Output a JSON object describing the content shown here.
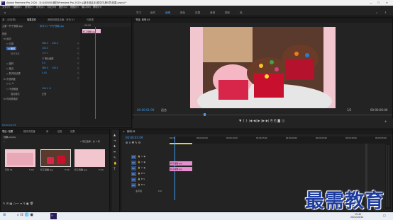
{
  "titlebar": {
    "title": "Adobe Premiere Pro 2020 - D:\\180000\\素材\\Premiere Pro 2020 从新手到高手\\源文件\\第5章\\效果.prproj *",
    "min": "—",
    "max": "☐",
    "close": "✕"
  },
  "menu": [
    "文件(F)",
    "编辑(E)",
    "剪辑(C)",
    "序列(S)",
    "标记(M)",
    "图形(G)",
    "视图(V)",
    "窗口(W)",
    "帮助(H)"
  ],
  "workspace": {
    "tabs": [
      "学习",
      "组件",
      "编辑",
      "颜色",
      "效果",
      "音频",
      "图形",
      "库"
    ],
    "active": "编辑"
  },
  "effect_controls": {
    "tabs": [
      "源：(无剪辑)",
      "效果控件",
      "音频剪辑混合器：序列 01",
      "元数据"
    ],
    "selected_tab": "效果控件",
    "clip_source": "主要 * 杯子蛋糕.jpg",
    "clip_sequence": "序列 01 * 杯子蛋糕.jpg",
    "timecode": "00:00",
    "clip_label": "杯子蛋糕.jpg",
    "rows": [
      {
        "label": "视频",
        "values": []
      },
      {
        "label": "fx 运动",
        "values": []
      },
      {
        "label": "○ 位置",
        "values": [
          "360.0",
          "240.0"
        ]
      },
      {
        "label": "○ 缩放",
        "values": [
          "100.0"
        ]
      },
      {
        "label": "缩放宽度",
        "values": [
          "100.0"
        ]
      },
      {
        "label": "",
        "values": [
          "等比缩放"
        ]
      },
      {
        "label": "○ 旋转",
        "values": [
          "0.0"
        ]
      },
      {
        "label": "○ 锚点",
        "values": [
          "360.0",
          "240.0"
        ]
      },
      {
        "label": "○ 防闪烁滤镜",
        "values": [
          "0.00"
        ]
      },
      {
        "label": "fx 不透明度",
        "values": []
      },
      {
        "label": "○ 不透明度",
        "values": [
          "100.0 %"
        ]
      },
      {
        "label": "混合模式",
        "values": [
          "正常"
        ]
      },
      {
        "label": "fx 时间重映射",
        "values": []
      }
    ],
    "footer_time": "00:00:01:09"
  },
  "program_monitor": {
    "tab": "节目: 序列 01",
    "timecode": "00:00:01:09",
    "fit": "适合",
    "fraction": "1/2",
    "duration": "00:00:06:00"
  },
  "project": {
    "tabs": [
      "项目: 效果",
      "媒体浏览器",
      "库",
      "信息",
      "效果"
    ],
    "name": "效果.prproj",
    "count": "1 项已选择，共 3 项",
    "items": [
      {
        "name": "序列 01",
        "duration": "5:00"
      },
      {
        "name": "杯子蛋糕.jpg",
        "duration": "5:00"
      },
      {
        "name": "杯子蛋糕.jpg",
        "duration": "5:00"
      }
    ]
  },
  "timeline": {
    "tab": "序列 01",
    "timecode": "00:00:01:09",
    "ruler": [
      "00:00",
      "00:00:05:00",
      "00:00:10:00",
      "00:00:15:00",
      "00:00:20:00",
      "00:00:25:00",
      "00:00:30:00",
      "00:00:35:00",
      "00:00:40:00"
    ],
    "tracks": [
      "V3",
      "V2",
      "V1",
      "A1",
      "A2",
      "A3"
    ],
    "clips": [
      {
        "name": "杯子蛋糕.jpg",
        "track": "V2"
      },
      {
        "name": "杯子蛋糕.jpg",
        "track": "V1"
      }
    ],
    "master": "主声道",
    "master_value": "0.0"
  },
  "taskbar": {
    "time": "15:45",
    "date": "2021/10/22"
  },
  "watermark": "最需教育"
}
